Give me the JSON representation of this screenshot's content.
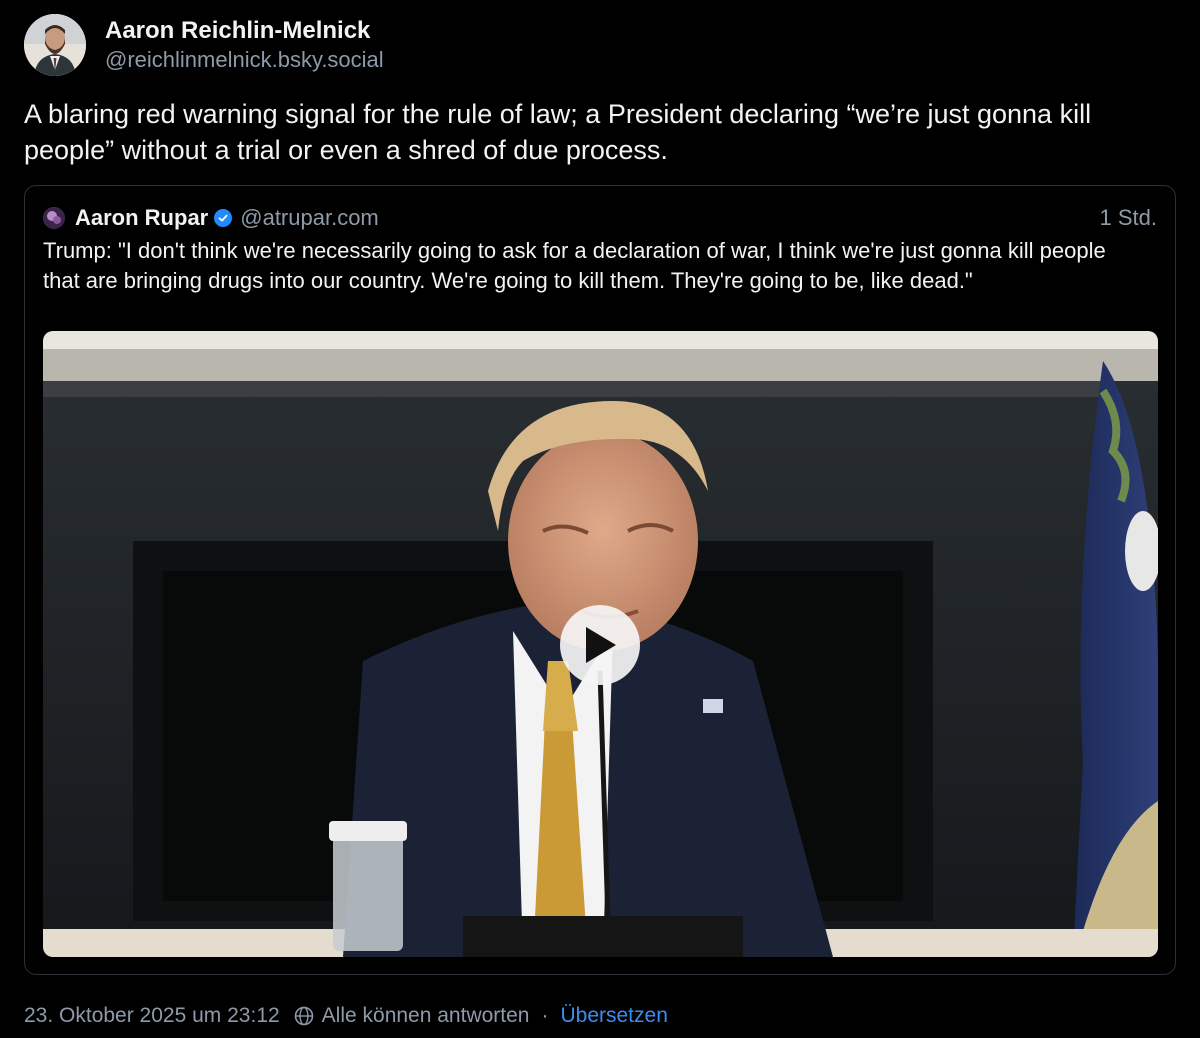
{
  "author": {
    "display_name": "Aaron Reichlin-Melnick",
    "handle": "@reichlinmelnick.bsky.social"
  },
  "post": {
    "text": "A blaring red warning signal for the rule of law; a President declaring “we’re just gonna kill people” without a trial or even a shred of due process."
  },
  "quote": {
    "display_name": "Aaron Rupar",
    "handle": "@atrupar.com",
    "time": "1 Std.",
    "text": "Trump: \"I don't think we're necessarily going to ask for a declaration of war, I think we're just gonna kill people that are bringing drugs into our country. We're going to kill them. They're going to be, like dead.\"",
    "verified": true,
    "media": {
      "type": "video",
      "icon": "play-icon"
    }
  },
  "footer": {
    "timestamp": "23. Oktober 2025 um 23:12",
    "reply_setting": "Alle können antworten",
    "separator": "·",
    "translate": "Übersetzen"
  },
  "colors": {
    "background": "#000000",
    "text_primary": "#f1f3f5",
    "text_secondary": "#8d9aa8",
    "link": "#3b8cf0",
    "verified_badge": "#208bfe",
    "card_border": "#2a3138"
  },
  "icons": [
    "globe-icon",
    "verified-badge-icon",
    "play-icon"
  ]
}
